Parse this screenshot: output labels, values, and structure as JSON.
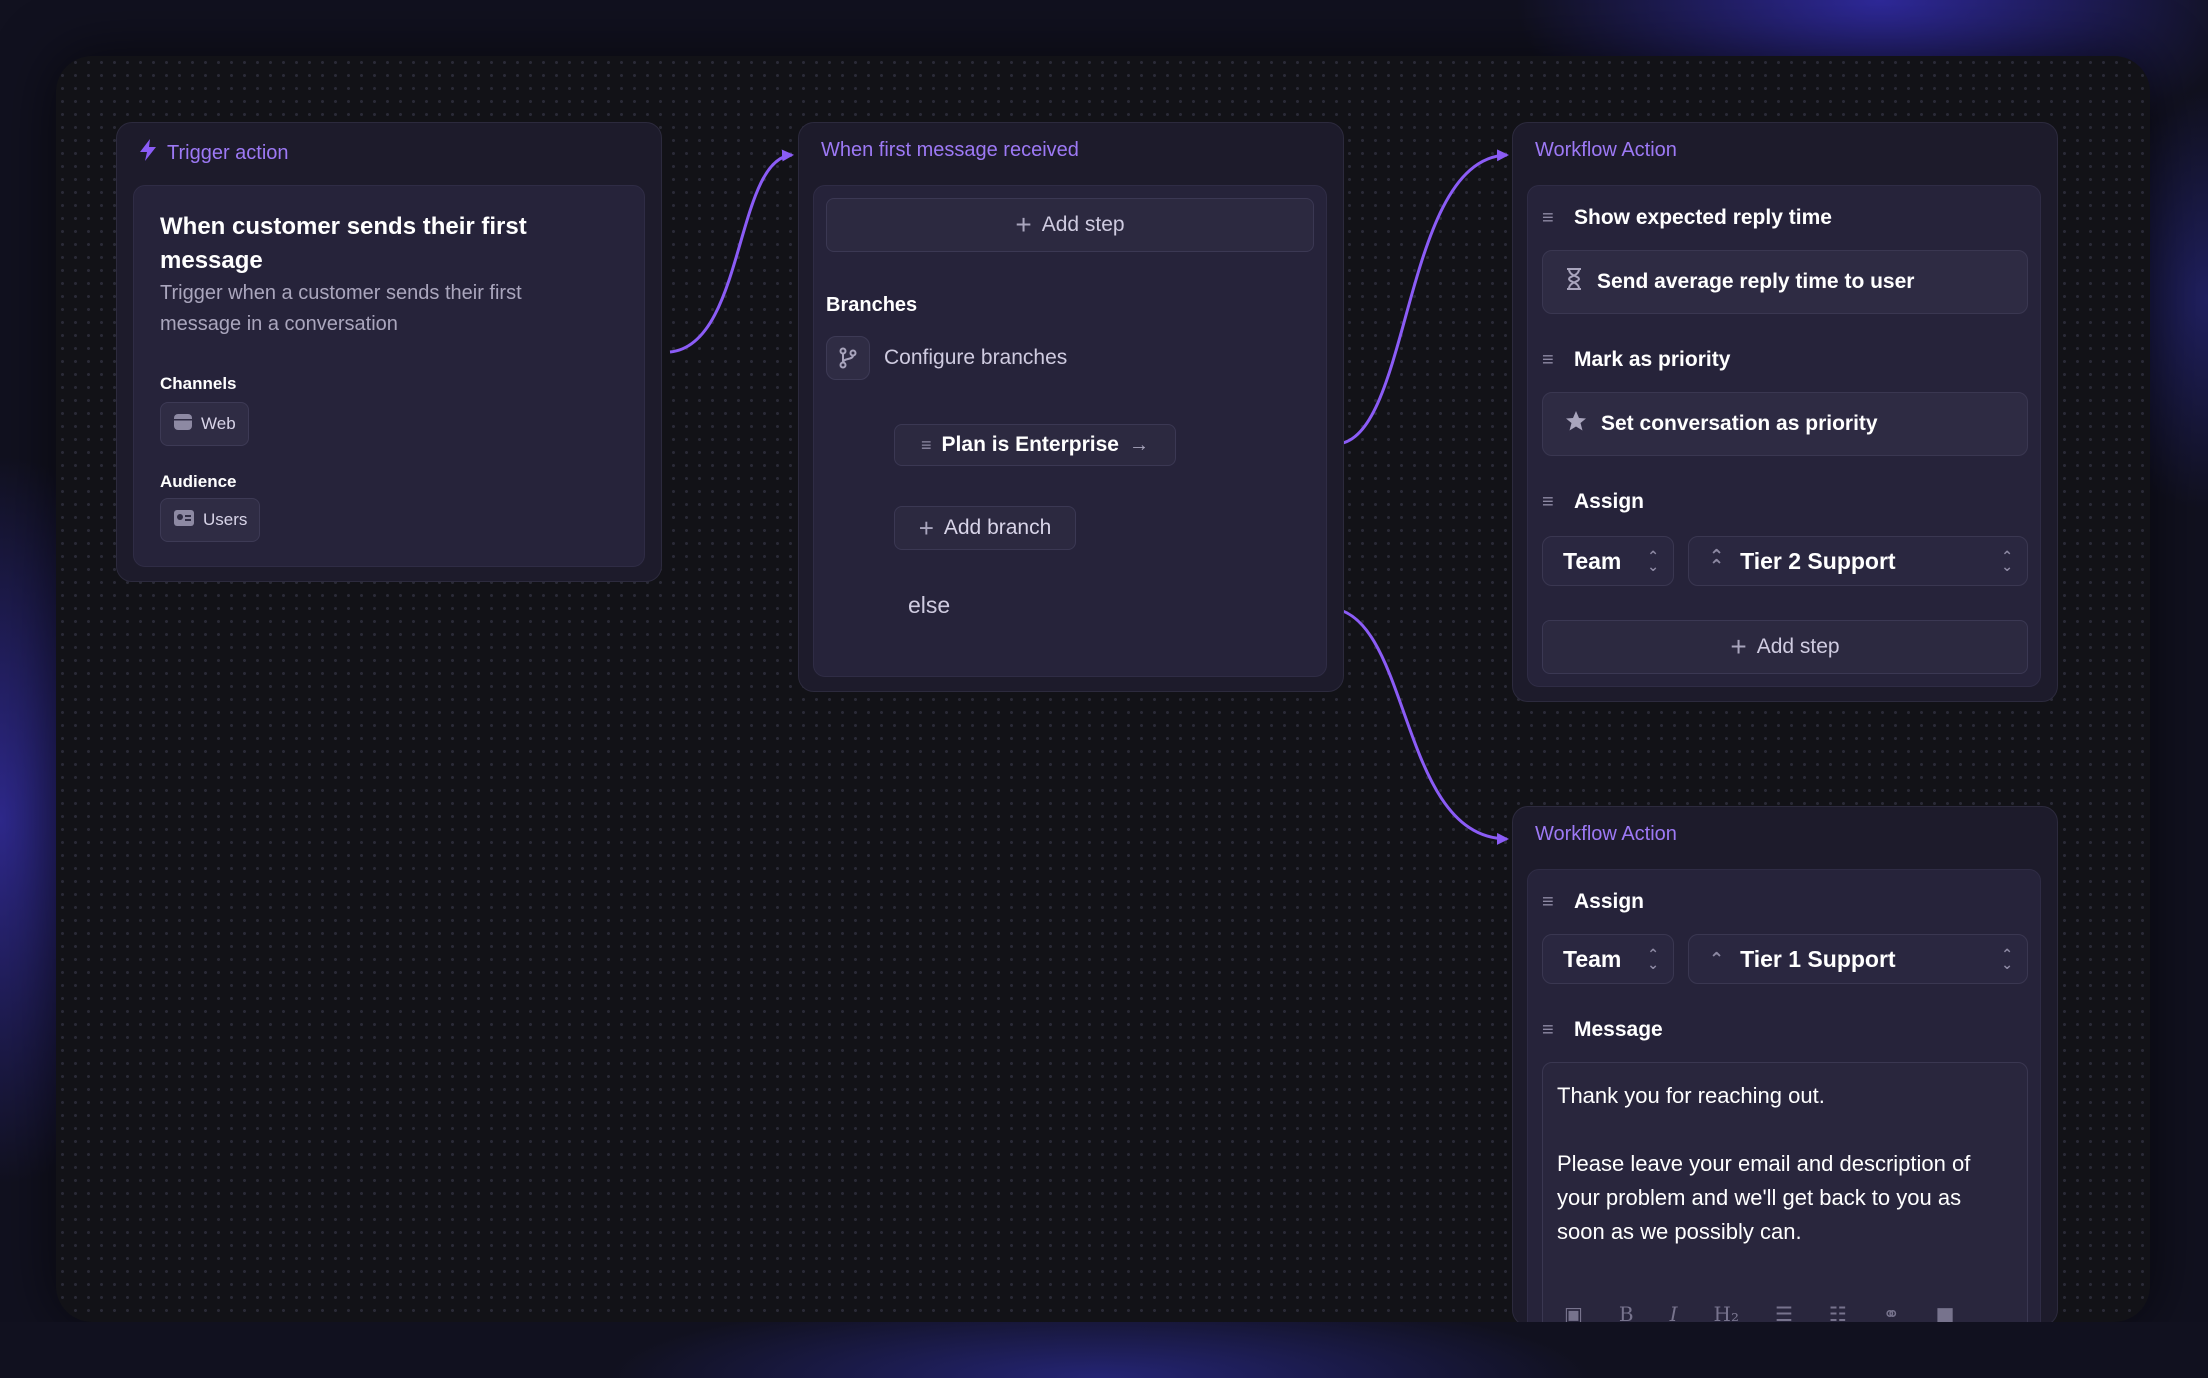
{
  "trigger_node": {
    "title": "Trigger action",
    "heading_line1": "When customer sends their first",
    "heading_line2": "message",
    "description_line1": "Trigger when a customer sends their first",
    "description_line2": "message in a conversation",
    "channels_label": "Channels",
    "channel": "Web",
    "audience_label": "Audience",
    "audience": "Users"
  },
  "branch_node": {
    "title": "When first message received",
    "add_step": "Add step",
    "branches_label": "Branches",
    "configure": "Configure branches",
    "branch_1": "Plan is Enterprise",
    "add_branch": "Add branch",
    "else": "else"
  },
  "action_node_1": {
    "title": "Workflow Action",
    "step1_label": "Show expected reply time",
    "step1_action": "Send average reply time to user",
    "step2_label": "Mark as priority",
    "step2_action": "Set conversation as priority",
    "step3_label": "Assign",
    "assign_type": "Team",
    "assign_value": "Tier 2 Support",
    "add_step": "Add step"
  },
  "action_node_2": {
    "title": "Workflow Action",
    "step1_label": "Assign",
    "assign_type": "Team",
    "assign_value": "Tier 1 Support",
    "step2_label": "Message",
    "message_line1": "Thank you for reaching out.",
    "message_line2": "Please leave your email and description of",
    "message_line3": "your problem and we'll get back to you as",
    "message_line4": "soon as we possibly can."
  },
  "toolbar_icons": [
    "image-icon",
    "bold-icon",
    "italic-icon",
    "heading2-icon",
    "bullet-list-icon",
    "numbered-list-icon",
    "link-icon",
    "video-icon"
  ],
  "colors": {
    "accent": "#9d79f5",
    "connector": "#8b5cf6",
    "background": "#121217"
  }
}
